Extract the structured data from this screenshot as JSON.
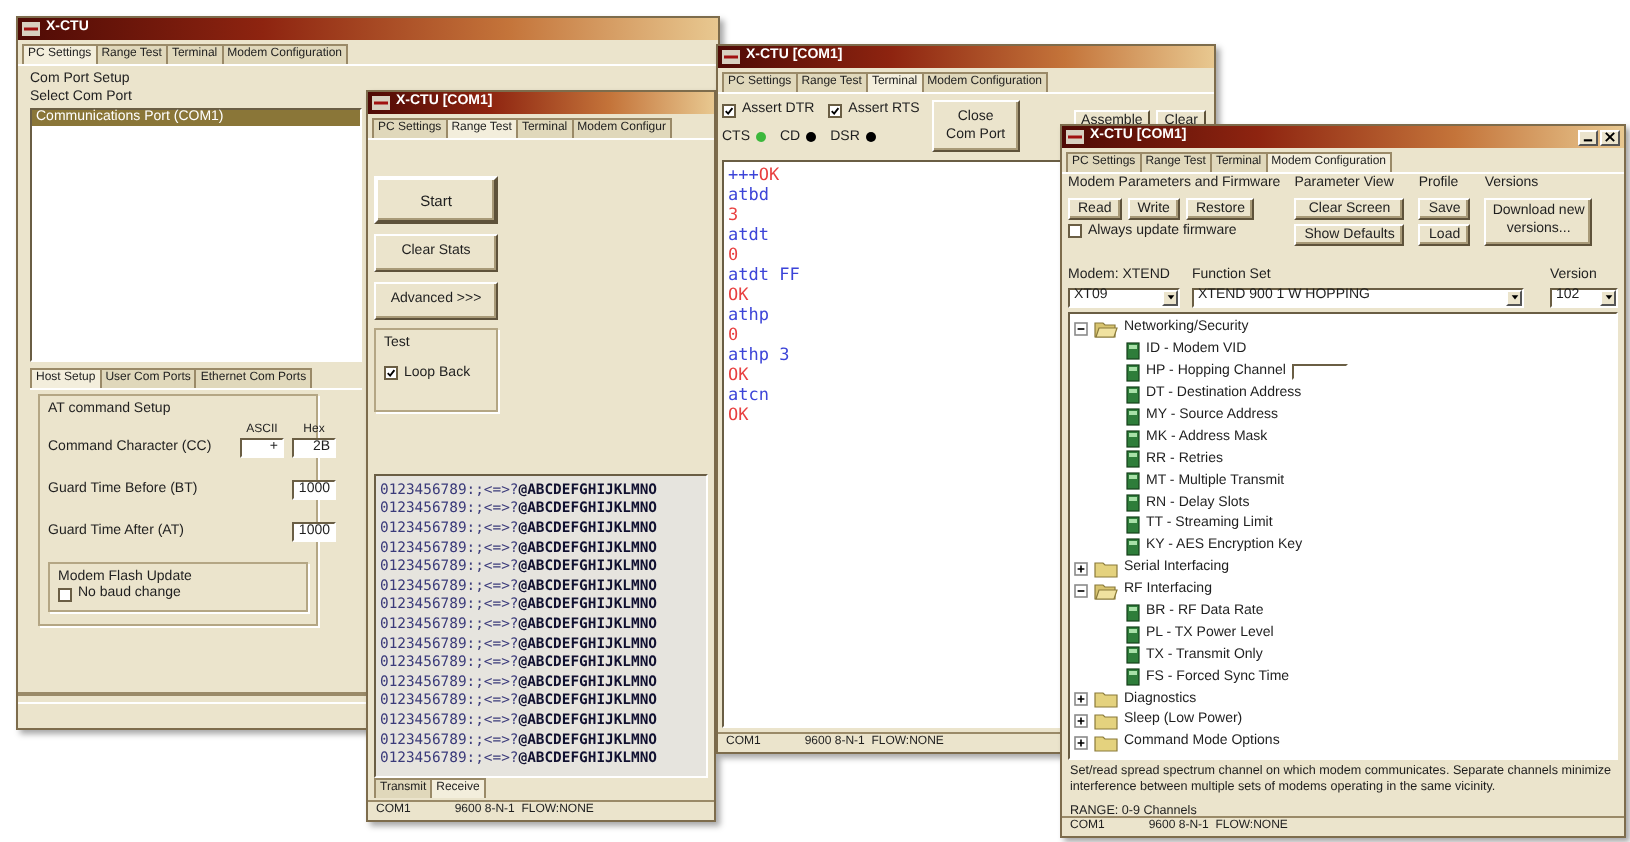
{
  "windows": [
    {
      "kind": "port_setup",
      "title": "X-CTU",
      "tabs": [
        {
          "label": "PC Settings",
          "selected": true
        },
        {
          "label": "Range Test",
          "selected": false
        },
        {
          "label": "Terminal",
          "selected": false
        },
        {
          "label": "Modem Configuration",
          "selected": false
        }
      ],
      "section_label": "Com Port Setup",
      "list_label": "Select Com Port",
      "ports": [
        {
          "label": "Communications Port (COM1)",
          "selected": true
        }
      ],
      "sub_tabs": [
        {
          "label": "Host Setup",
          "selected": true
        },
        {
          "label": "User Com Ports",
          "selected": false
        },
        {
          "label": "Ethernet Com Ports",
          "selected": false
        }
      ],
      "at_group": {
        "label": "AT command Setup",
        "columns": [
          "ASCII",
          "Hex"
        ],
        "fields": [
          {
            "label": "Command Character (CC)",
            "values": [
              "+",
              "2B"
            ]
          },
          {
            "label": "Guard Time Before (BT)",
            "values": [
              "1000"
            ]
          },
          {
            "label": "Guard Time After (AT)",
            "values": [
              "1000"
            ]
          }
        ]
      },
      "flash_group": {
        "label": "Modem Flash Update",
        "option": {
          "label": "No baud change",
          "checked": false
        }
      }
    },
    {
      "kind": "range_test",
      "title": "X-CTU [COM1]",
      "tabs": [
        {
          "label": "PC Settings",
          "selected": false
        },
        {
          "label": "Range Test",
          "selected": true
        },
        {
          "label": "Terminal",
          "selected": false
        },
        {
          "label": "Modem Configur",
          "selected": false
        }
      ],
      "buttons": [
        "Start",
        "Clear Stats",
        "Advanced >>>"
      ],
      "test_group": {
        "label": "Test",
        "options": [
          {
            "label": "Loop Back",
            "checked": true
          }
        ]
      },
      "lines": [
        "0123456789:;<=>?**@ABCDEFGHIJKLMNO**",
        "0123456789:;<=>?**@ABCDEFGHIJKLMNO**",
        "0123456789:;<=>?**@ABCDEFGHIJKLMNO**",
        "0123456789:;<=>?**@ABCDEFGHIJKLMNO**",
        "0123456789:;<=>?**@ABCDEFGHIJKLMNO**",
        "0123456789:;<=>?**@ABCDEFGHIJKLMNO**",
        "0123456789:;<=>?**@ABCDEFGHIJKLMNO**",
        "0123456789:;<=>?**@ABCDEFGHIJKLMNO**",
        "0123456789:;<=>?**@ABCDEFGHIJKLMNO**",
        "0123456789:;<=>?**@ABCDEFGHIJKLMNO**",
        "0123456789:;<=>?**@ABCDEFGHIJKLMNO**",
        "0123456789:;<=>?**@ABCDEFGHIJKLMNO**",
        "0123456789:;<=>?**@ABCDEFGHIJKLMNO**",
        "0123456789:;<=>?**@ABCDEFGHIJKLMNO**",
        "0123456789:;<=>?**@ABCDEFGHIJKLMNO**"
      ],
      "data_tabs": [
        {
          "label": "Transmit",
          "selected": false
        },
        {
          "label": "Receive",
          "selected": true
        }
      ],
      "status": [
        "COM1",
        "9600 8-N-1  FLOW:NONE"
      ]
    },
    {
      "kind": "terminal",
      "title": "X-CTU [COM1]",
      "tabs": [
        {
          "label": "PC Settings",
          "selected": false
        },
        {
          "label": "Range Test",
          "selected": false
        },
        {
          "label": "Terminal",
          "selected": true
        },
        {
          "label": "Modem Configuration",
          "selected": false
        }
      ],
      "line_controls": [
        {
          "label": "Assert DTR",
          "checked": true
        },
        {
          "label": "Assert RTS",
          "checked": true
        }
      ],
      "indicators": [
        {
          "label": "CTS",
          "color": "#3cb83c"
        },
        {
          "label": "CD",
          "color": "#000000"
        },
        {
          "label": "DSR",
          "color": "#000000"
        }
      ],
      "buttons": [
        "Close Com Port",
        "Assemble",
        "Clear"
      ],
      "terminal_lines": [
        [
          {
            "text": "+++",
            "kind": "sent"
          },
          {
            "text": "OK",
            "kind": "received"
          }
        ],
        [
          {
            "text": "atbd",
            "kind": "sent"
          }
        ],
        [
          {
            "text": "3",
            "kind": "received"
          }
        ],
        [
          {
            "text": "atdt",
            "kind": "sent"
          }
        ],
        [
          {
            "text": "0",
            "kind": "received"
          }
        ],
        [
          {
            "text": "atdt FF",
            "kind": "sent"
          }
        ],
        [
          {
            "text": "OK",
            "kind": "received"
          }
        ],
        [
          {
            "text": "athp",
            "kind": "sent"
          }
        ],
        [
          {
            "text": "0",
            "kind": "received"
          }
        ],
        [
          {
            "text": "athp 3",
            "kind": "sent"
          }
        ],
        [
          {
            "text": "OK",
            "kind": "received"
          }
        ],
        [
          {
            "text": "atcn",
            "kind": "sent"
          }
        ],
        [
          {
            "text": "OK",
            "kind": "received"
          }
        ]
      ],
      "status": [
        "COM1",
        "9600 8-N-1  FLOW:NONE"
      ]
    },
    {
      "kind": "modem_config",
      "title": "X-CTU [COM1]",
      "window_controls": true,
      "tabs": [
        {
          "label": "PC Settings",
          "selected": false
        },
        {
          "label": "Range Test",
          "selected": false
        },
        {
          "label": "Terminal",
          "selected": false
        },
        {
          "label": "Modem Configuration",
          "selected": true
        }
      ],
      "button_groups": [
        {
          "label": "Modem Parameters and Firmware",
          "buttons": [
            "Read",
            "Write",
            "Restore"
          ]
        },
        {
          "label": "Parameter View",
          "buttons": [
            "Clear Screen",
            "Show Defaults"
          ]
        },
        {
          "label": "Profile",
          "buttons": [
            "Save",
            "Load"
          ]
        },
        {
          "label": "Versions",
          "buttons": [
            "Download new versions..."
          ]
        }
      ],
      "always_update": {
        "label": "Always update firmware",
        "checked": false
      },
      "selects": [
        {
          "label": "Modem: XTEND",
          "value": "XT09"
        },
        {
          "label": "Function Set",
          "value": "XTEND 900 1 W HOPPING"
        },
        {
          "label": "Version",
          "value": "102"
        }
      ],
      "tree": [
        {
          "kind": "folder",
          "label": "Networking/Security",
          "expanded": true,
          "children": [
            {
              "kind": "parameter",
              "label": "ID - Modem VID"
            },
            {
              "kind": "editing",
              "label": "HP - Hopping Channel"
            },
            {
              "kind": "parameter",
              "label": "DT - Destination Address"
            },
            {
              "kind": "parameter",
              "label": "MY - Source Address"
            },
            {
              "kind": "parameter",
              "label": "MK - Address Mask"
            },
            {
              "kind": "parameter",
              "label": "RR - Retries"
            },
            {
              "kind": "parameter",
              "label": "MT - Multiple Transmit"
            },
            {
              "kind": "parameter",
              "label": "RN - Delay Slots"
            },
            {
              "kind": "parameter",
              "label": "TT - Streaming Limit"
            },
            {
              "kind": "parameter",
              "label": "KY - AES Encryption Key"
            }
          ]
        },
        {
          "kind": "folder",
          "label": "Serial Interfacing",
          "expanded": false
        },
        {
          "kind": "folder",
          "label": "RF Interfacing",
          "expanded": true,
          "children": [
            {
              "kind": "parameter",
              "label": "BR - RF Data Rate"
            },
            {
              "kind": "parameter",
              "label": "PL - TX Power Level"
            },
            {
              "kind": "parameter",
              "label": "TX - Transmit Only"
            },
            {
              "kind": "parameter",
              "label": "FS - Forced Sync Time"
            }
          ]
        },
        {
          "kind": "folder",
          "label": "Diagnostics",
          "expanded": false
        },
        {
          "kind": "folder",
          "label": "Sleep (Low Power)",
          "expanded": false
        },
        {
          "kind": "folder",
          "label": "Command Mode Options",
          "expanded": false
        }
      ],
      "description": "Set/read spread spectrum channel on which modem communicates. Separate channels minimize interference between multiple sets of modems operating in the same vicinity.",
      "range": "RANGE: 0-9 Channels",
      "status": [
        "COM1",
        "9600 8-N-1  FLOW:NONE"
      ]
    }
  ]
}
